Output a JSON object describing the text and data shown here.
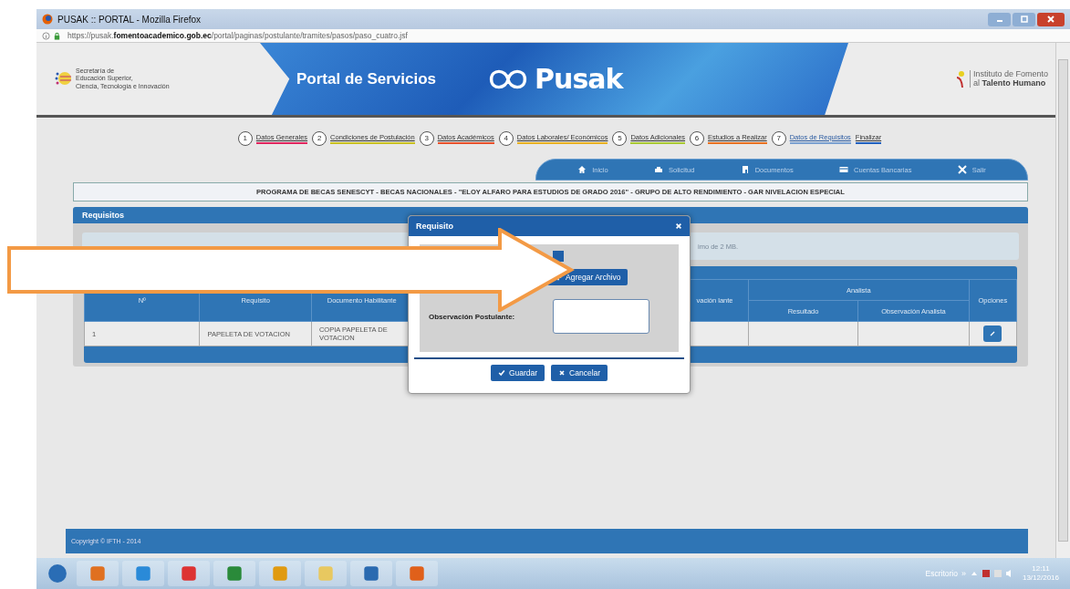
{
  "window": {
    "title": "PUSAK :: PORTAL - Mozilla Firefox",
    "url": "https://pusak.**fomentoacademico.gob.ec**/portal/paginas/postulante/tramites/pasos/paso_cuatro.jsf"
  },
  "header": {
    "left_logo_lines": [
      "Secretaría de",
      "Educación Superior,",
      "Ciencia, Tecnología e Innovación"
    ],
    "banner_title": "Portal de Servicios",
    "brand": "Pusak",
    "right_logo_lines": [
      "Instituto de Fomento",
      "al **Talento Humano**"
    ]
  },
  "steps": [
    {
      "number": "1",
      "label": "Datos Generales",
      "color": "#e0245e",
      "selected": false
    },
    {
      "number": "2",
      "label": "Condiciones de Postulación",
      "color": "#c8c020",
      "selected": false
    },
    {
      "number": "3",
      "label": "Datos Académicos",
      "color": "#e8502a",
      "selected": false
    },
    {
      "number": "4",
      "label": "Datos Laborales/ Económicos",
      "color": "#e8b020",
      "selected": false
    },
    {
      "number": "5",
      "label": "Datos Adicionales",
      "color": "#a8c830",
      "selected": false
    },
    {
      "number": "6",
      "label": "Estudios a Realizar",
      "color": "#e87020",
      "selected": false
    },
    {
      "number": "7",
      "label": "Datos de Requisitos",
      "color": "#7aa0d0",
      "selected": true
    },
    {
      "label": "Finalizar",
      "color": "#2060c0",
      "selected": false
    }
  ],
  "nav": [
    {
      "kind": "home",
      "label": "Inicio"
    },
    {
      "kind": "print",
      "label": "Solicitud"
    },
    {
      "kind": "doc",
      "label": "Documentos"
    },
    {
      "kind": "card",
      "label": "Cuentas Bancarias"
    },
    {
      "kind": "exit",
      "label": "Salir"
    }
  ],
  "program_title": "PROGRAMA DE BECAS SENESCYT - BECAS NACIONALES - \"ELOY ALFARO PARA ESTUDIOS DE GRADO 2016\" - GRUPO DE ALTO RENDIMIENTO - GAR NIVELACION ESPECIAL",
  "panel": {
    "title": "Requisitos",
    "info_text": "imo de 2 MB.",
    "table": {
      "columns": [
        "Nº",
        "Requisito",
        "Documento Habilitante",
        "vación lante"
      ],
      "group": "Analista",
      "group_columns": [
        "Resultado",
        "Observación Analista"
      ],
      "options_column": "Opciones",
      "rows": [
        {
          "cells": [
            "1",
            "PAPELETA DE VOTACION",
            "COPIA PAPELETA DE VOTACION"
          ]
        }
      ]
    }
  },
  "dialog": {
    "title": "Requisito",
    "upload_button": "Agregar Archivo",
    "observation_label": "Observación Postulante:",
    "buttons": [
      {
        "kind": "save",
        "label": "Guardar"
      },
      {
        "kind": "cancel",
        "label": "Cancelar"
      }
    ]
  },
  "footer": "Copyright © IFTH - 2014",
  "taskbar": {
    "apps": [
      {
        "kind": "start"
      },
      {
        "kind": "media"
      },
      {
        "kind": "ie"
      },
      {
        "kind": "chrome"
      },
      {
        "kind": "excel"
      },
      {
        "kind": "outlook"
      },
      {
        "kind": "folder"
      },
      {
        "kind": "lync"
      },
      {
        "kind": "firefox"
      }
    ],
    "desktop_label": "Escritorio",
    "chevron": "»",
    "time": "12:11",
    "date": "13/12/2016"
  }
}
